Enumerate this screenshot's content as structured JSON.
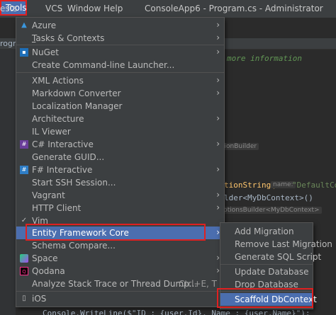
{
  "menubar": {
    "items": [
      "ests",
      "Tools",
      "VCS",
      "Window",
      "Help"
    ],
    "window_title": "ConsoleApp6 - Program.cs - Administrator"
  },
  "editor": {
    "tab_fragment": "rogra",
    "comment": "more information",
    "hint_options": "tionBuilder",
    "code_conn_a": "tionString(",
    "hint_name": "name:",
    "code_conn_b": "\"DefaultCo",
    "code_builder": "lder<MyDbContext>()",
    "hint_builder": "ptionsBuilder<MyDbContext>",
    "code_bottom": "Console.WriteLine($\"ID : {user.Id}, Name : {user.Name}\");"
  },
  "tools_menu": {
    "items": [
      {
        "label": "Azure",
        "icon": "azure-icon",
        "submenu": true
      },
      {
        "label": "Tasks & Contexts",
        "submenu": true
      },
      {
        "label": "NuGet",
        "icon": "nuget-icon",
        "submenu": true
      },
      {
        "label": "Create Command-line Launcher..."
      },
      {
        "label": "XML Actions",
        "submenu": true
      },
      {
        "label": "Markdown Converter",
        "submenu": true
      },
      {
        "label": "Localization Manager"
      },
      {
        "label": "Architecture",
        "submenu": true
      },
      {
        "label": "IL Viewer"
      },
      {
        "label": "C# Interactive",
        "icon": "csharp-interactive-icon",
        "submenu": true
      },
      {
        "label": "Generate GUID..."
      },
      {
        "label": "F# Interactive",
        "icon": "fsharp-interactive-icon",
        "submenu": true
      },
      {
        "label": "Start SSH Session..."
      },
      {
        "label": "Vagrant",
        "submenu": true
      },
      {
        "label": "HTTP Client",
        "submenu": true
      },
      {
        "label": "Vim",
        "icon": "checkmark-icon"
      },
      {
        "label": "Entity Framework Core",
        "submenu": true,
        "selected": true
      },
      {
        "label": "Schema Compare..."
      },
      {
        "label": "Space",
        "icon": "space-icon",
        "submenu": true
      },
      {
        "label": "Qodana",
        "icon": "qodana-icon",
        "submenu": true
      },
      {
        "label": "Analyze Stack Trace or Thread Dump...",
        "shortcut": "Ctrl+E, T"
      },
      {
        "label": "iOS",
        "icon": "ios-icon"
      }
    ]
  },
  "ef_submenu": {
    "items": [
      {
        "label": "Add Migration"
      },
      {
        "label": "Remove Last Migration"
      },
      {
        "label": "Generate SQL Script"
      },
      {
        "label": "Update Database"
      },
      {
        "label": "Drop Database"
      },
      {
        "label": "Scaffold DbContext",
        "selected": true
      }
    ]
  },
  "colors": {
    "menu_bg": "#3c3f41",
    "selection": "#4b6eaf",
    "highlight_box": "#e02020",
    "editor_bg": "#2b2b2b"
  }
}
